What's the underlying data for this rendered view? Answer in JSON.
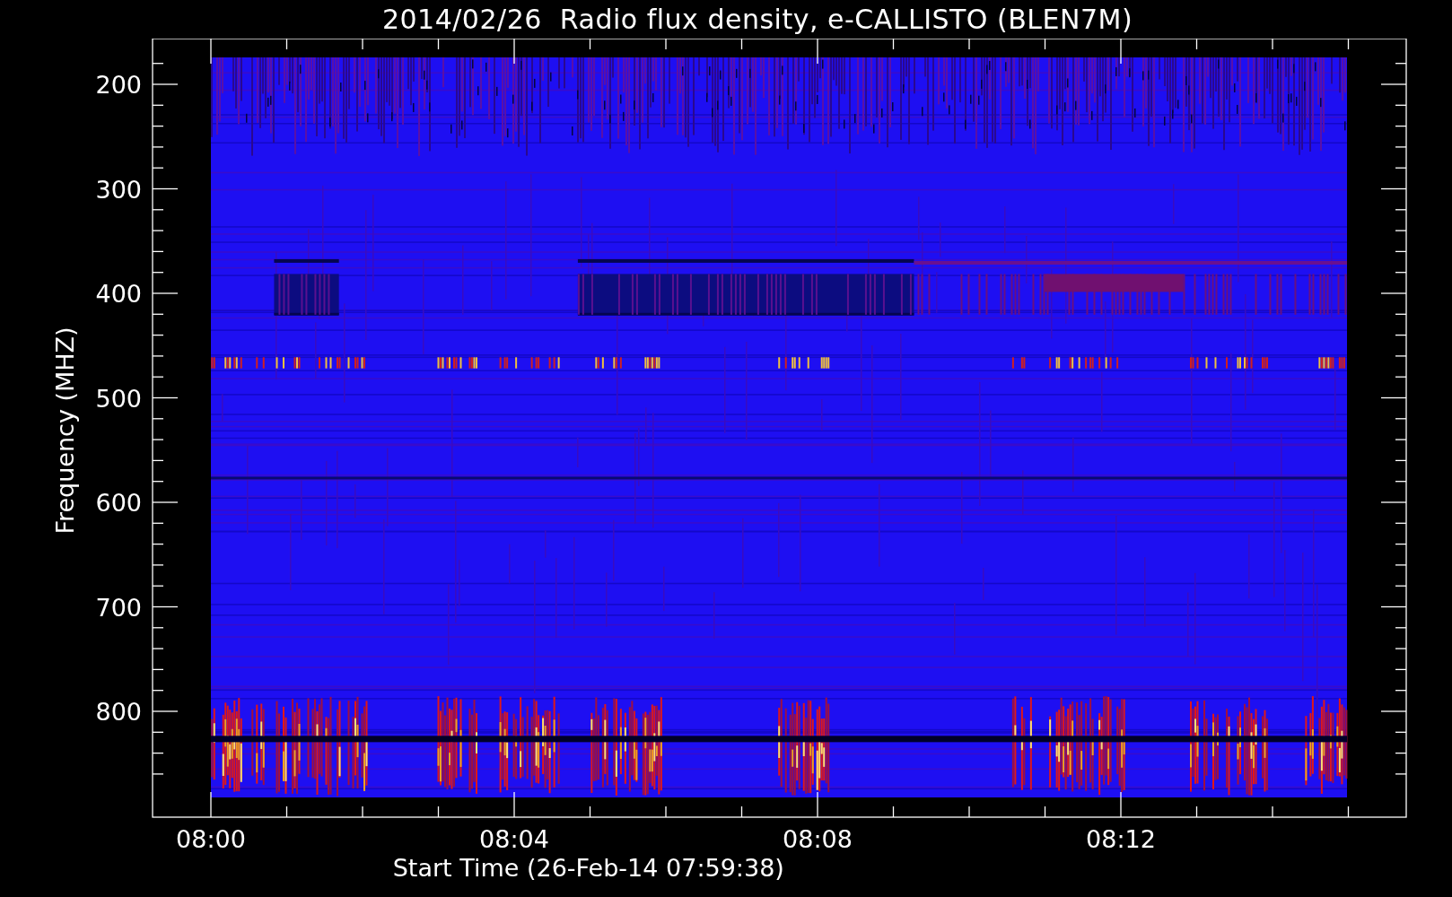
{
  "title": "2014/02/26  Radio flux density, e-CALLISTO (BLEN7M)",
  "y_axis": {
    "label": "Frequency (MHZ)",
    "ticks": [
      "200",
      "300",
      "400",
      "500",
      "600",
      "700",
      "800"
    ]
  },
  "x_axis": {
    "label": "Start Time (26-Feb-14 07:59:38)",
    "ticks": [
      "08:00",
      "08:04",
      "08:08",
      "08:12"
    ]
  }
}
